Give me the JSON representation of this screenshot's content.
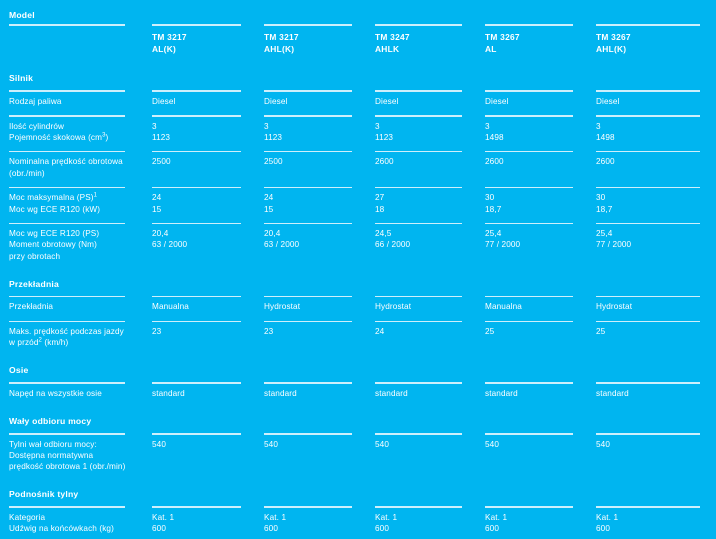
{
  "theme": {
    "background": "#00b5f0",
    "text": "#ffffff",
    "rule": "#cdeffc"
  },
  "columns": [
    {
      "name": "TM 3217",
      "variant": "AL(K)"
    },
    {
      "name": "TM 3217",
      "variant": "AHL(K)"
    },
    {
      "name": "TM 3247",
      "variant": "AHLK"
    },
    {
      "name": "TM 3267",
      "variant": "AL"
    },
    {
      "name": "TM 3267",
      "variant": "AHL(K)"
    }
  ],
  "sections": {
    "model": {
      "title": "Model"
    },
    "engine": {
      "title": "Silnik",
      "rows": {
        "fuel_type": {
          "label": "Rodzaj paliwa",
          "values": [
            "Diesel",
            "Diesel",
            "Diesel",
            "Diesel",
            "Diesel"
          ]
        },
        "cylinders_displacement": {
          "label_line1": "Ilość cylindrów",
          "label_line2_pre": "Pojemność skokowa (cm",
          "label_line2_sup": "3",
          "label_line2_post": ")",
          "values_line1": [
            "3",
            "3",
            "3",
            "3",
            "3"
          ],
          "values_line2": [
            "1123",
            "1123",
            "1123",
            "1498",
            "1498"
          ]
        },
        "nominal_speed": {
          "label_line1": "Nominalna prędkość obrotowa",
          "label_line2": "(obr./min)",
          "values": [
            "2500",
            "2500",
            "2600",
            "2600",
            "2600"
          ]
        },
        "power": {
          "label_line1_pre": "Moc maksymalna (PS)",
          "label_line1_sup": "1",
          "label_line2": "Moc wg ECE R120 (kW)",
          "values_line1": [
            "24",
            "24",
            "27",
            "30",
            "30"
          ],
          "values_line2": [
            "15",
            "15",
            "18",
            "18,7",
            "18,7"
          ]
        },
        "torque": {
          "label_line1": "Moc wg ECE R120 (PS)",
          "label_line2": "Moment obrotowy (Nm)",
          "label_line3": "przy obrotach",
          "values_line1": [
            "20,4",
            "20,4",
            "24,5",
            "25,4",
            "25,4"
          ],
          "values_line2": [
            "63 / 2000",
            "63 / 2000",
            "66 / 2000",
            "77 / 2000",
            "77 / 2000"
          ]
        }
      }
    },
    "transmission": {
      "title": "Przekładnia",
      "rows": {
        "gearbox": {
          "label": "Przekładnia",
          "values": [
            "Manualna",
            "Hydrostat",
            "Hydrostat",
            "Manualna",
            "Hydrostat"
          ]
        },
        "max_speed": {
          "label_line1": "Maks. prędkość podczas jazdy",
          "label_line2_pre": "w przód",
          "label_line2_sup": "2",
          "label_line2_post": " (km/h)",
          "values": [
            "23",
            "23",
            "24",
            "25",
            "25"
          ]
        }
      }
    },
    "axles": {
      "title": "Osie",
      "rows": {
        "all_wheel_drive": {
          "label": "Napęd na wszystkie osie",
          "values": [
            "standard",
            "standard",
            "standard",
            "standard",
            "standard"
          ]
        }
      }
    },
    "pto": {
      "title": "Wały odbioru mocy",
      "rows": {
        "rear_pto": {
          "label_line1": "Tylni wał odbioru mocy:",
          "label_line2": "Dostępna normatywna",
          "label_line3": "prędkość obrotowa 1 (obr./min)",
          "values": [
            "540",
            "540",
            "540",
            "540",
            "540"
          ]
        }
      }
    },
    "rear_linkage": {
      "title": "Podnośnik tylny",
      "rows": {
        "category_capacity": {
          "label_line1": "Kategoria",
          "label_line2": "Udźwig na końcówkach (kg)",
          "values_line1": [
            "Kat. 1",
            "Kat. 1",
            "Kat. 1",
            "Kat. 1",
            "Kat. 1"
          ],
          "values_line2": [
            "600",
            "600",
            "600",
            "600",
            "600"
          ]
        }
      }
    }
  }
}
